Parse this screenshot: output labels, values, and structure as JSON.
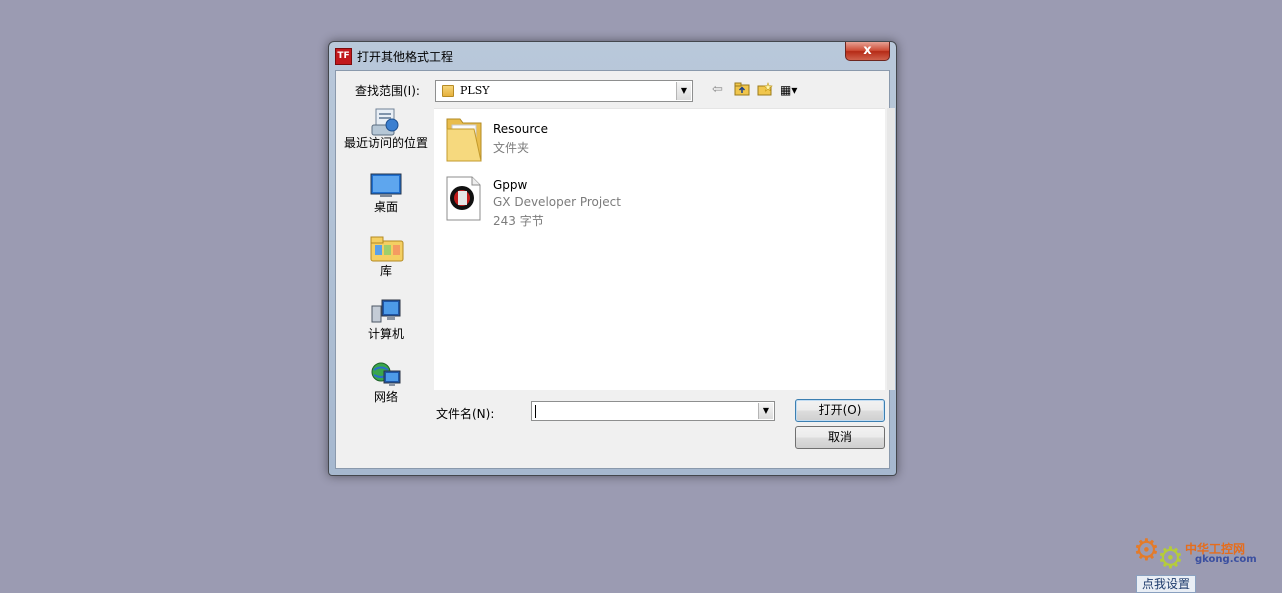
{
  "window": {
    "title": "打开其他格式工程",
    "app_icon_glyph": "TF",
    "close_glyph": "x"
  },
  "lookin": {
    "label": "查找范围(I):",
    "value": "PLSY",
    "arrow": "▼"
  },
  "toolbar": {
    "back_glyph": "⇦",
    "up_glyph": "⤴",
    "new_folder_glyph": "✱",
    "views_glyph": "▦▾"
  },
  "places": [
    {
      "label": "最近访问的位置",
      "icon": "recent-places-icon"
    },
    {
      "label": "桌面",
      "icon": "desktop-icon"
    },
    {
      "label": "库",
      "icon": "libraries-icon"
    },
    {
      "label": "计算机",
      "icon": "computer-icon"
    },
    {
      "label": "网络",
      "icon": "network-icon"
    }
  ],
  "files": [
    {
      "name": "Resource",
      "line2": "文件夹",
      "line3": "",
      "icon": "folder-icon"
    },
    {
      "name": "Gppw",
      "line2": "GX Developer Project",
      "line3": "243 字节",
      "icon": "gx-project-icon"
    }
  ],
  "filename": {
    "label": "文件名(N):",
    "value": "",
    "arrow": "▼"
  },
  "buttons": {
    "open_label": "打开(O)",
    "cancel_label": "取消"
  },
  "watermark": {
    "text_a": "中华工控网",
    "text_b": "gkong.com",
    "tip": "点我设置"
  },
  "colors": {
    "desktop": "#9b9bb2",
    "titlebar": "#b9c8da",
    "close_button": "#c74532",
    "client": "#f0f0f0"
  }
}
